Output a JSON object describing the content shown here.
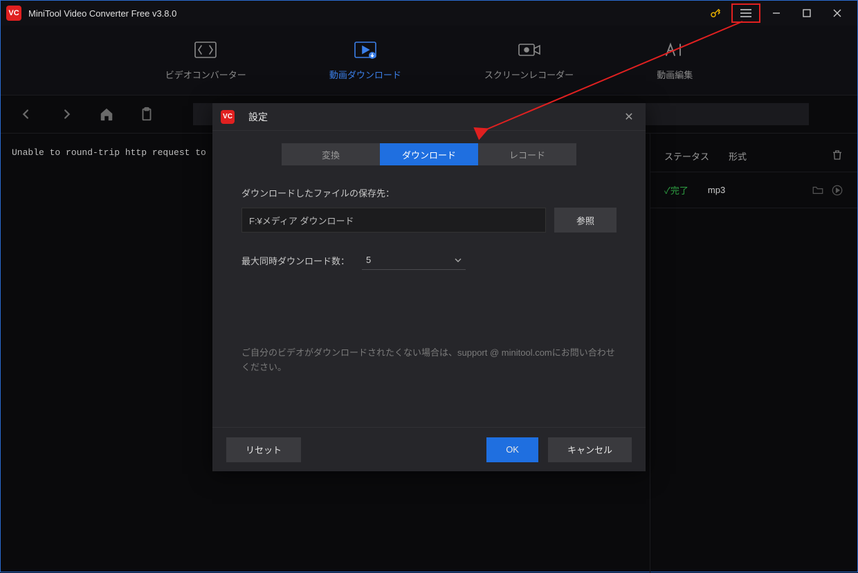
{
  "app": {
    "title": "MiniTool Video Converter Free v3.8.0",
    "logo_text": "VC"
  },
  "nav": {
    "items": [
      {
        "label": "ビデオコンバーター"
      },
      {
        "label": "動画ダウンロード"
      },
      {
        "label": "スクリーンレコーダー"
      },
      {
        "label": "動画編集"
      }
    ]
  },
  "content": {
    "error_text": "Unable to round-trip http request to"
  },
  "list": {
    "header_status": "ステータス",
    "header_format": "形式",
    "row_status": "✓完了",
    "row_format": "mp3"
  },
  "modal": {
    "title": "設定",
    "tabs": {
      "convert": "変換",
      "download": "ダウンロード",
      "record": "レコード"
    },
    "save_to_label": "ダウンロードしたファイルの保存先：",
    "save_path": "F:¥メディア ダウンロード",
    "browse": "参照",
    "max_dl_label": "最大同時ダウンロード数：",
    "max_dl_value": "5",
    "help": "ご自分のビデオがダウンロードされたくない場合は、support @ minitool.comにお問い合わせください。",
    "reset": "リセット",
    "ok": "OK",
    "cancel": "キャンセル"
  }
}
